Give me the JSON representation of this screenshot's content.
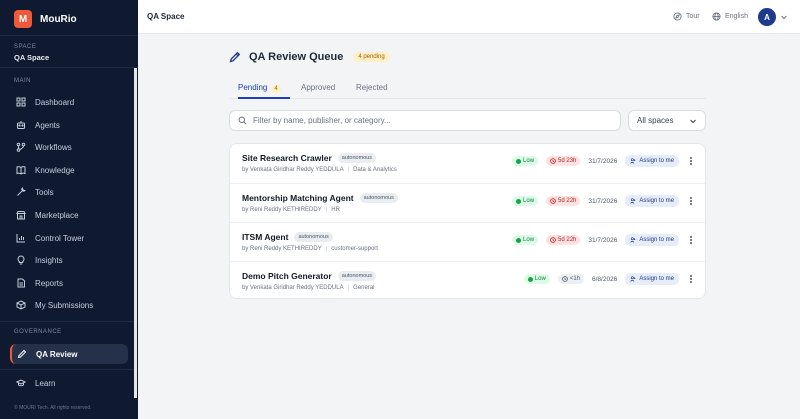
{
  "brand": {
    "logo_letter": "M",
    "name": "MouRio",
    "accent": "#f05a3a"
  },
  "space": {
    "label": "SPACE",
    "name": "QA Space"
  },
  "sidebar": {
    "main_label": "MAIN",
    "items": [
      {
        "label": "Dashboard",
        "icon": "dashboard-icon"
      },
      {
        "label": "Agents",
        "icon": "robot-icon"
      },
      {
        "label": "Workflows",
        "icon": "workflow-icon"
      },
      {
        "label": "Knowledge",
        "icon": "book-icon"
      },
      {
        "label": "Tools",
        "icon": "wrench-icon"
      },
      {
        "label": "Marketplace",
        "icon": "store-icon"
      },
      {
        "label": "Control Tower",
        "icon": "chart-icon"
      },
      {
        "label": "Insights",
        "icon": "lightbulb-icon"
      },
      {
        "label": "Reports",
        "icon": "document-icon"
      },
      {
        "label": "My Submissions",
        "icon": "package-icon"
      }
    ],
    "governance_label": "GOVERNANCE",
    "active_item": {
      "label": "QA Review",
      "icon": "pen-icon"
    },
    "learn": {
      "label": "Learn",
      "icon": "graduation-cap-icon"
    },
    "footer": "© MOURI Tech. All rights reserved."
  },
  "topbar": {
    "title": "QA Space",
    "tour_label": "Tour",
    "language_label": "English",
    "avatar_letter": "A"
  },
  "main": {
    "title": "QA Review Queue",
    "pending_badge": "4 pending",
    "tabs": [
      {
        "label": "Pending",
        "count": "4"
      },
      {
        "label": "Approved"
      },
      {
        "label": "Rejected"
      }
    ],
    "search_placeholder": "Filter by name, publisher, or category...",
    "space_filter": "All spaces",
    "rows": [
      {
        "name": "Site Research Crawler",
        "tag": "autonomous",
        "by": "by Venkata Giridhar Reddy YEDDULA",
        "category": "Data & Analytics",
        "risk": "Low",
        "sla": "5d 23h",
        "sla_state": "overdue",
        "date": "31/7/2026",
        "action": "Assign to me"
      },
      {
        "name": "Mentorship Matching Agent",
        "tag": "autonomous",
        "by": "by Reni Reddy KETHIREDDY",
        "category": "HR",
        "risk": "Low",
        "sla": "5d 22h",
        "sla_state": "overdue",
        "date": "31/7/2026",
        "action": "Assign to me"
      },
      {
        "name": "ITSM Agent",
        "tag": "autonomous",
        "by": "by Reni Reddy KETHIREDDY",
        "category": "customer-support",
        "risk": "Low",
        "sla": "5d 22h",
        "sla_state": "overdue",
        "date": "31/7/2026",
        "action": "Assign to me"
      },
      {
        "name": "Demo Pitch Generator",
        "tag": "autonomous",
        "by": "by Venkata Giridhar Reddy YEDDULA",
        "category": "General",
        "risk": "Low",
        "sla": "<1h",
        "sla_state": "ok",
        "date": "6/8/2026",
        "action": "Assign to me"
      }
    ]
  }
}
